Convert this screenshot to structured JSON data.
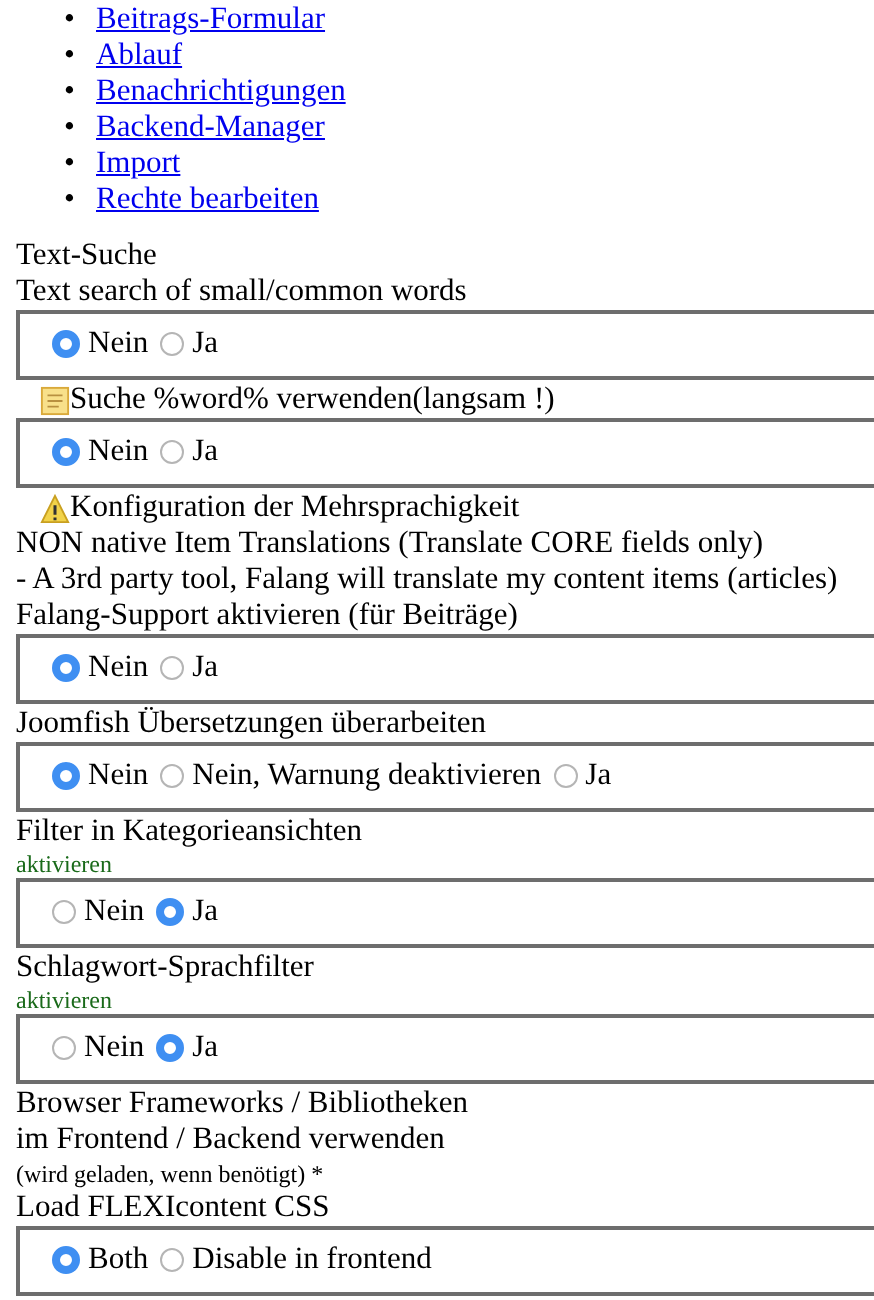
{
  "links": [
    {
      "marker": "•",
      "label": "Beitrags-Formular"
    },
    {
      "marker": "•",
      "label": "Ablauf"
    },
    {
      "marker": "•",
      "label": "Benachrichtigungen"
    },
    {
      "marker": "•",
      "label": "Backend-Manager"
    },
    {
      "marker": "•",
      "label": "Import"
    },
    {
      "marker": "•",
      "label": "Rechte bearbeiten"
    }
  ],
  "blocks": [
    {
      "kind": "label",
      "text": "Text-Suche"
    },
    {
      "kind": "label",
      "text": "Text search of small/common words"
    },
    {
      "kind": "radios",
      "options": [
        {
          "label": "Nein",
          "selected": true
        },
        {
          "label": "Ja",
          "selected": false
        }
      ]
    },
    {
      "kind": "note",
      "text": "Suche %word% verwenden(langsam !)"
    },
    {
      "kind": "radios",
      "options": [
        {
          "label": "Nein",
          "selected": true
        },
        {
          "label": "Ja",
          "selected": false
        }
      ]
    },
    {
      "kind": "warning",
      "text": "Konfiguration der Mehrsprachigkeit"
    },
    {
      "kind": "label",
      "text": "NON native Item Translations (Translate CORE fields only)"
    },
    {
      "kind": "label",
      "text": "- A 3rd party tool, Falang will translate my content items (articles)"
    },
    {
      "kind": "label",
      "text": "Falang-Support aktivieren (für Beiträge)"
    },
    {
      "kind": "radios",
      "options": [
        {
          "label": "Nein",
          "selected": true
        },
        {
          "label": "Ja",
          "selected": false
        }
      ]
    },
    {
      "kind": "label",
      "text": "Joomfish Übersetzungen überarbeiten"
    },
    {
      "kind": "radios",
      "options": [
        {
          "label": "Nein",
          "selected": true
        },
        {
          "label": "Nein, Warnung deaktivieren",
          "selected": false
        },
        {
          "label": "Ja",
          "selected": false
        }
      ]
    },
    {
      "kind": "label",
      "text": "Filter in Kategorieansichten"
    },
    {
      "kind": "hint",
      "text": "aktivieren"
    },
    {
      "kind": "radios",
      "options": [
        {
          "label": "Nein",
          "selected": false
        },
        {
          "label": "Ja",
          "selected": true
        }
      ]
    },
    {
      "kind": "label",
      "text": "Schlagwort-Sprachfilter"
    },
    {
      "kind": "hint",
      "text": "aktivieren"
    },
    {
      "kind": "radios",
      "options": [
        {
          "label": "Nein",
          "selected": false
        },
        {
          "label": "Ja",
          "selected": true
        }
      ]
    },
    {
      "kind": "label",
      "text": "Browser Frameworks / Bibliotheken"
    },
    {
      "kind": "label",
      "text": "im Frontend / Backend verwenden"
    },
    {
      "kind": "small",
      "text": "(wird geladen, wenn benötigt) *"
    },
    {
      "kind": "label",
      "text": "Load FLEXIcontent CSS"
    },
    {
      "kind": "radios",
      "options": [
        {
          "label": "Both",
          "selected": true
        },
        {
          "label": "Disable in frontend",
          "selected": false
        }
      ]
    }
  ]
}
